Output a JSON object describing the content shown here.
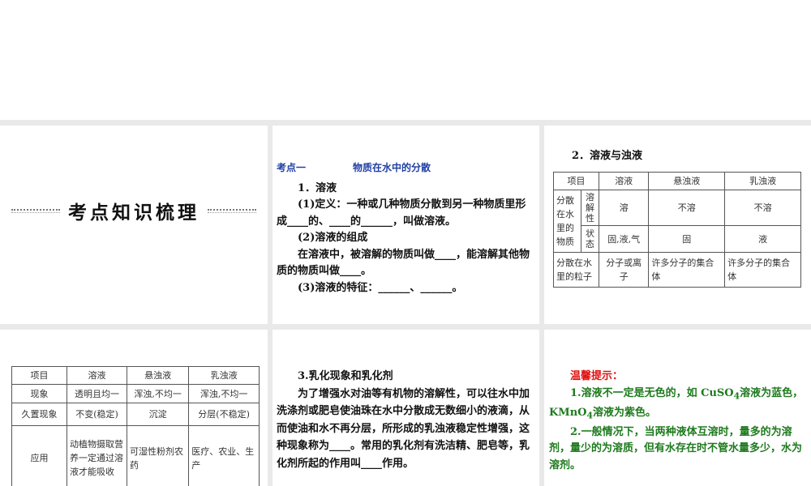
{
  "section_title": "考点知识梳理",
  "p2": {
    "kaodian": "考点一",
    "topic": "物质在水中的分散",
    "h1": "1．溶液",
    "lines": [
      "(1)定义：一种或几种物质分散到另一种物质里形成____的、____的______，叫做溶液。",
      "(2)溶液的组成",
      "在溶液中，被溶解的物质叫做____，能溶解其他物质的物质叫做____。",
      "(3)溶液的特征：______、______。"
    ]
  },
  "p3": {
    "heading": "2．溶液与浊液",
    "header": [
      "项目",
      "溶液",
      "悬浊液",
      "乳浊液"
    ],
    "group": "分散在水里的物质",
    "r1": [
      "溶解性",
      "溶",
      "不溶",
      "不溶"
    ],
    "r2": [
      "状态",
      "固,液,气",
      "固",
      "液"
    ],
    "r3": [
      "分散在水里的粒子",
      "分子或离子",
      "许多分子的集合体",
      "许多分子的集合体"
    ]
  },
  "p4": {
    "header": [
      "项目",
      "溶液",
      "悬浊液",
      "乳浊液"
    ],
    "rows": [
      [
        "现象",
        "透明且均一",
        "浑浊,不均一",
        "浑浊,不均一"
      ],
      [
        "久置现象",
        "不变(稳定)",
        "沉淀",
        "分层(不稳定)"
      ],
      [
        "应用",
        "动植物摄取营养一定通过溶液才能吸收",
        "可湿性粉剂农药",
        "医疗、农业、生产"
      ]
    ]
  },
  "p5": {
    "heading": "3.乳化现象和乳化剂",
    "body": "为了增强水对油等有机物的溶解性，可以往水中加洗涤剂或肥皂使油珠在水中分散成无数细小的液滴，从而使油和水不再分层，所形成的乳浊液稳定性增强，这种现象称为____。常用的乳化剂有洗洁精、肥皂等，乳化剂所起的作用叫____作用。"
  },
  "p6": {
    "heading": "温馨提示：",
    "t1a": "1.溶液不一定是无色的，如 CuSO",
    "sub": "4",
    "t1b": "溶液为蓝色，KMnO",
    "t1c": "溶液为紫色。",
    "t2": "2.一般情况下，当两种液体互溶时，量多的为溶剂，量少的为溶质，但有水存在时不管水量多少，水为溶剂。"
  },
  "colors": {
    "blue": "#1f3fa5",
    "green": "#1e7a1e",
    "red": "#e01010"
  }
}
